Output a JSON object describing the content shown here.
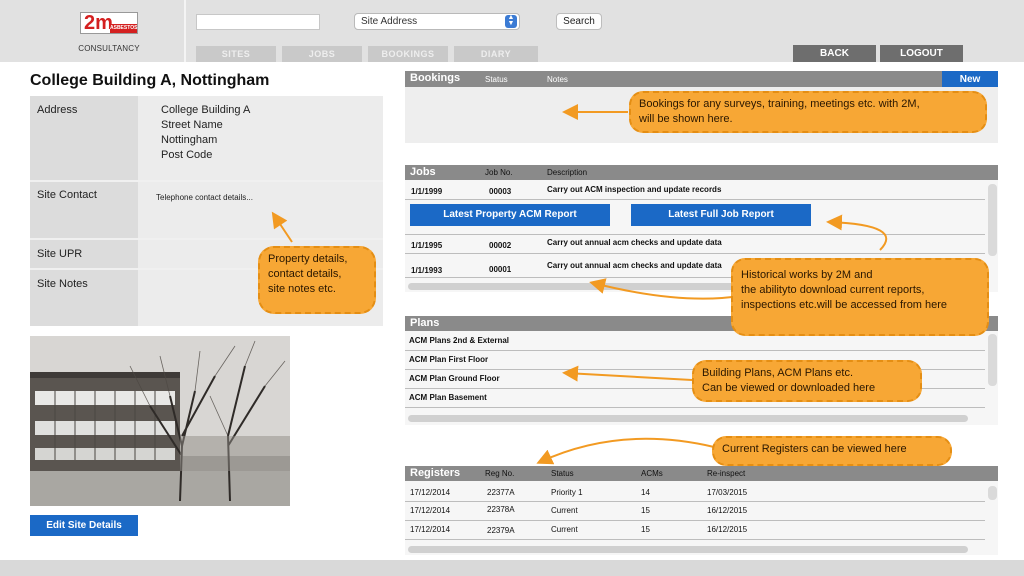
{
  "header": {
    "logo": {
      "main": "2m",
      "badge": "ASBESTOS",
      "sub": "CONSULTANCY"
    },
    "search_value": "",
    "site_select": {
      "selected": "Site Address"
    },
    "search_button": "Search",
    "nav_tabs": [
      "SITES",
      "JOBS",
      "BOOKINGS",
      "DIARY"
    ],
    "back_button": "BACK",
    "logout_button": "LOGOUT"
  },
  "site": {
    "title": "College Building A, Nottingham",
    "address_label": "Address",
    "address_lines": [
      "College Building A",
      "Street Name",
      "Nottingham",
      "Post Code"
    ],
    "contact_label": "Site Contact",
    "contact_value": "Telephone contact details...",
    "upr_label": "Site UPR",
    "notes_label": "Site Notes",
    "edit_button": "Edit Site Details"
  },
  "bookings": {
    "title": "Bookings",
    "columns": [
      "Status",
      "Notes"
    ],
    "new_button": "New"
  },
  "jobs": {
    "title": "Jobs",
    "columns": [
      "Job No.",
      "Description"
    ],
    "rows": [
      {
        "date": "1/1/1999",
        "job_no": "00003",
        "description": "Carry out ACM inspection and update records"
      },
      {
        "date": "1/1/1995",
        "job_no": "00002",
        "description": "Carry out annual acm checks and update data"
      },
      {
        "date": "1/1/1993",
        "job_no": "00001",
        "description": "Carry out annual acm checks and update data"
      }
    ],
    "acm_report_button": "Latest Property ACM Report",
    "full_report_button": "Latest Full Job Report"
  },
  "plans": {
    "title": "Plans",
    "items": [
      "ACM Plans 2nd & External",
      "ACM Plan First Floor",
      "ACM Plan Ground Floor",
      "ACM Plan Basement"
    ]
  },
  "registers": {
    "title": "Registers",
    "columns": [
      "Reg No.",
      "Status",
      "ACMs",
      "Re-inspect"
    ],
    "rows": [
      {
        "date": "17/12/2014",
        "reg_no": "22377A",
        "status": "Priority 1",
        "acms": "14",
        "reinspect": "17/03/2015"
      },
      {
        "date": "17/12/2014",
        "reg_no": "22378A",
        "status": "Current",
        "acms": "15",
        "reinspect": "16/12/2015"
      },
      {
        "date": "17/12/2014",
        "reg_no": "22379A",
        "status": "Current",
        "acms": "15",
        "reinspect": "16/12/2015"
      }
    ]
  },
  "callouts": {
    "bookings": [
      "Bookings for any surveys, training, meetings etc. with 2M,",
      "will be shown here."
    ],
    "property": [
      "Property details,",
      "contact details,",
      "site notes etc."
    ],
    "historical": [
      "Historical works by 2M and",
      "the abilityto download current reports,",
      "inspections etc.will be accessed from here"
    ],
    "plans": [
      "Building Plans, ACM Plans etc.",
      "Can be viewed or downloaded here"
    ],
    "registers": [
      "Current Registers can be viewed here"
    ]
  },
  "colors": {
    "accent_blue": "#1b69c6",
    "callout_orange": "#f7a735",
    "panel_grey": "#8a8a8a"
  }
}
